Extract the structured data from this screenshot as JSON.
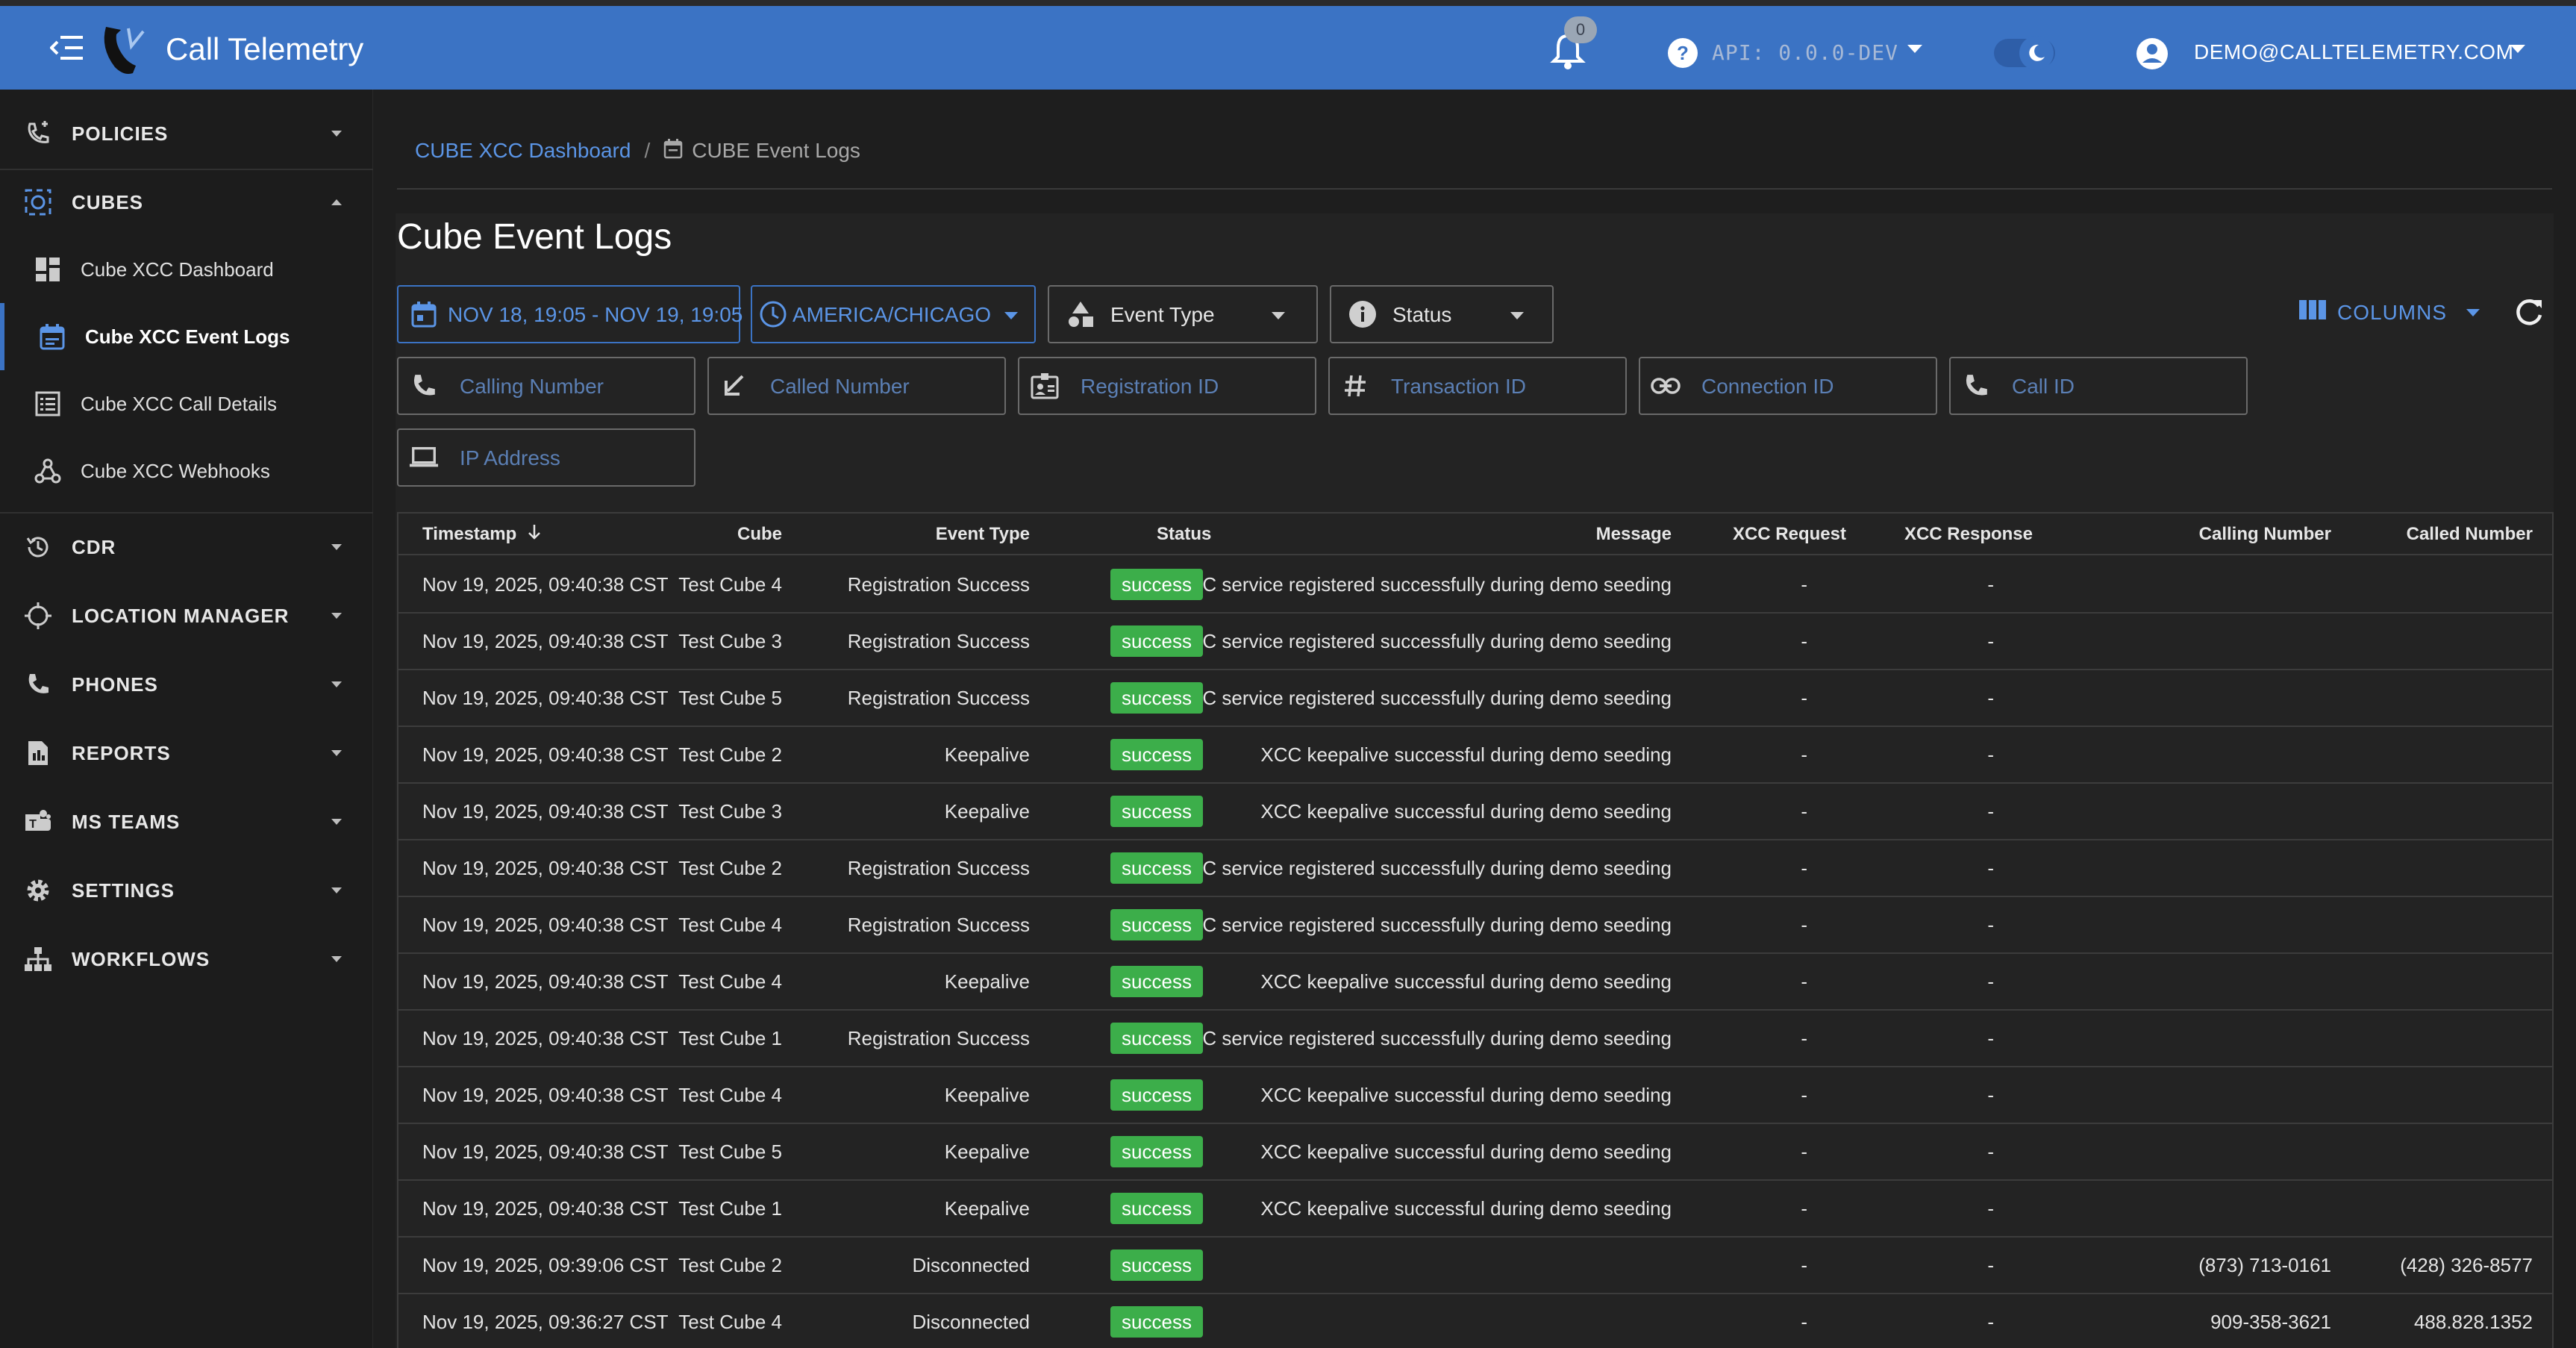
{
  "app": {
    "title": "Call Telemetry"
  },
  "header": {
    "notifications_count": "0",
    "api_version": "API: 0.0.0-DEV",
    "user_email": "DEMO@CALLTELEMETRY.COM"
  },
  "sidebar": {
    "sections": [
      {
        "label": "POLICIES",
        "icon": "phone-policy-icon"
      },
      {
        "label": "CUBES",
        "icon": "cube-icon"
      },
      {
        "label": "CDR",
        "icon": "history-icon"
      },
      {
        "label": "LOCATION MANAGER",
        "icon": "crosshair-icon"
      },
      {
        "label": "PHONES",
        "icon": "phone-icon"
      },
      {
        "label": "REPORTS",
        "icon": "report-icon"
      },
      {
        "label": "MS TEAMS",
        "icon": "teams-icon"
      },
      {
        "label": "SETTINGS",
        "icon": "gear-icon"
      },
      {
        "label": "WORKFLOWS",
        "icon": "sitemap-icon"
      }
    ],
    "cube_items": [
      {
        "label": "Cube XCC Dashboard",
        "icon": "dashboard-icon"
      },
      {
        "label": "Cube XCC Event Logs",
        "icon": "calendar-icon"
      },
      {
        "label": "Cube XCC Call Details",
        "icon": "list-icon"
      },
      {
        "label": "Cube XCC Webhooks",
        "icon": "webhook-icon"
      }
    ]
  },
  "breadcrumb": {
    "parent": "CUBE XCC Dashboard",
    "separator": "/",
    "current": "CUBE Event Logs"
  },
  "page": {
    "title": "Cube Event Logs"
  },
  "filters": {
    "date_range": "NOV 18, 19:05 - NOV 19, 19:05",
    "timezone": "AMERICA/CHICAGO",
    "event_type": "Event Type",
    "status": "Status",
    "calling_number": "Calling Number",
    "called_number": "Called Number",
    "registration_id": "Registration ID",
    "transaction_id": "Transaction ID",
    "connection_id": "Connection ID",
    "call_id": "Call ID",
    "ip_address": "IP Address",
    "columns_label": "COLUMNS"
  },
  "colors": {
    "accent": "#3b73c4",
    "link": "#5b95e6",
    "success": "#3cae4a"
  },
  "table": {
    "columns": [
      "Timestamp",
      "Cube",
      "Event Type",
      "Status",
      "Message",
      "XCC Request",
      "XCC Response",
      "Calling Number",
      "Called Number"
    ],
    "sort_icon": "arrow-down-icon",
    "rows": [
      [
        "Nov 19, 2025, 09:40:38 CST",
        "Test Cube 4",
        "Registration Success",
        "success",
        "XCC service registered successfully during demo seeding",
        "-",
        "-",
        "",
        ""
      ],
      [
        "Nov 19, 2025, 09:40:38 CST",
        "Test Cube 3",
        "Registration Success",
        "success",
        "XCC service registered successfully during demo seeding",
        "-",
        "-",
        "",
        ""
      ],
      [
        "Nov 19, 2025, 09:40:38 CST",
        "Test Cube 5",
        "Registration Success",
        "success",
        "XCC service registered successfully during demo seeding",
        "-",
        "-",
        "",
        ""
      ],
      [
        "Nov 19, 2025, 09:40:38 CST",
        "Test Cube 2",
        "Keepalive",
        "success",
        "XCC keepalive successful during demo seeding",
        "-",
        "-",
        "",
        ""
      ],
      [
        "Nov 19, 2025, 09:40:38 CST",
        "Test Cube 3",
        "Keepalive",
        "success",
        "XCC keepalive successful during demo seeding",
        "-",
        "-",
        "",
        ""
      ],
      [
        "Nov 19, 2025, 09:40:38 CST",
        "Test Cube 2",
        "Registration Success",
        "success",
        "XCC service registered successfully during demo seeding",
        "-",
        "-",
        "",
        ""
      ],
      [
        "Nov 19, 2025, 09:40:38 CST",
        "Test Cube 4",
        "Registration Success",
        "success",
        "XCC service registered successfully during demo seeding",
        "-",
        "-",
        "",
        ""
      ],
      [
        "Nov 19, 2025, 09:40:38 CST",
        "Test Cube 4",
        "Keepalive",
        "success",
        "XCC keepalive successful during demo seeding",
        "-",
        "-",
        "",
        ""
      ],
      [
        "Nov 19, 2025, 09:40:38 CST",
        "Test Cube 1",
        "Registration Success",
        "success",
        "XCC service registered successfully during demo seeding",
        "-",
        "-",
        "",
        ""
      ],
      [
        "Nov 19, 2025, 09:40:38 CST",
        "Test Cube 4",
        "Keepalive",
        "success",
        "XCC keepalive successful during demo seeding",
        "-",
        "-",
        "",
        ""
      ],
      [
        "Nov 19, 2025, 09:40:38 CST",
        "Test Cube 5",
        "Keepalive",
        "success",
        "XCC keepalive successful during demo seeding",
        "-",
        "-",
        "",
        ""
      ],
      [
        "Nov 19, 2025, 09:40:38 CST",
        "Test Cube 1",
        "Keepalive",
        "success",
        "XCC keepalive successful during demo seeding",
        "-",
        "-",
        "",
        ""
      ],
      [
        "Nov 19, 2025, 09:39:06 CST",
        "Test Cube 2",
        "Disconnected",
        "success",
        "",
        "-",
        "-",
        "(873) 713-0161",
        "(428) 326-8577"
      ],
      [
        "Nov 19, 2025, 09:36:27 CST",
        "Test Cube 4",
        "Disconnected",
        "success",
        "",
        "-",
        "-",
        "909-358-3621",
        "488.828.1352"
      ]
    ]
  }
}
